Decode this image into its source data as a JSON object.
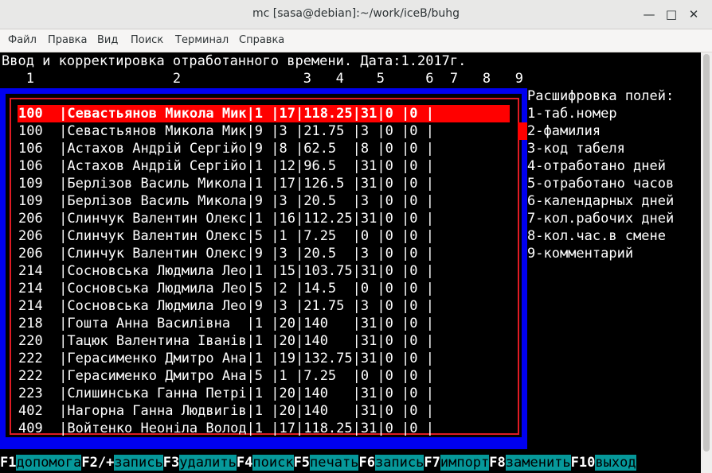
{
  "window": {
    "title": "mc [sasa@debian]:~/work/iceB/buhg"
  },
  "menu": [
    "Файл",
    "Правка",
    "Вид",
    "Поиск",
    "Терминал",
    "Справка"
  ],
  "header": {
    "line": "Ввод и корректировка отработанного времени. Дата:1.2017г.",
    "columns": "   1                 2               3   4    5     6  7   8   9"
  },
  "rows": [
    "100  |Севастьянов Микола Мик|1 |17|118.25|31|0 |0 |",
    "100  |Севастьянов Микола Мик|9 |3 |21.75 |3 |0 |0 |",
    "106  |Астахов Андрій Сергійо|9 |8 |62.5  |8 |0 |0 |",
    "106  |Астахов Андрій Сергійо|1 |12|96.5  |31|0 |0 |",
    "109  |Берлізов Василь Микола|1 |17|126.5 |31|0 |0 |",
    "109  |Берлізов Василь Микола|9 |3 |20.5  |3 |0 |0 |",
    "206  |Слинчук Валентин Олекс|1 |16|112.25|31|0 |0 |",
    "206  |Слинчук Валентин Олекс|5 |1 |7.25  |0 |0 |0 |",
    "206  |Слинчук Валентин Олекс|9 |3 |20.5  |3 |0 |0 |",
    "214  |Сосновська Людмила Лео|1 |15|103.75|31|0 |0 |",
    "214  |Сосновська Людмила Лео|5 |2 |14.5  |0 |0 |0 |",
    "214  |Сосновська Людмила Лео|9 |3 |21.75 |3 |0 |0 |",
    "218  |Гошта Анна Василівна  |1 |20|140   |31|0 |0 |",
    "220  |Тацюк Валентина Іванів|1 |20|140   |31|0 |0 |",
    "222  |Герасименко Дмитро Ана|1 |19|132.75|31|0 |0 |",
    "222  |Герасименко Дмитро Ана|5 |1 |7.25  |0 |0 |0 |",
    "223  |Слишинська Ганна Петрі|1 |20|140   |31|0 |0 |",
    "402  |Нагорна Ганна Людвигів|1 |20|140   |31|0 |0 |",
    "409  |Войтенко Неоніла Волод|1 |17|118.25|31|0 |0 |"
  ],
  "legend": [
    "Расшифровка полей:",
    "1-таб.номер",
    "2-фамилия",
    "3-код табеля",
    "4-отработано дней",
    "5-отработано часов",
    "6-календарных дней",
    "7-кол.рабочих дней",
    "8-кол.час.в смене",
    "9-комментарий"
  ],
  "fkeys": [
    {
      "key": "F1",
      "label": "допомога"
    },
    {
      "key": "F2/+",
      "label": "запись"
    },
    {
      "key": "F3",
      "label": "удалить"
    },
    {
      "key": "F4",
      "label": "поиск"
    },
    {
      "key": "F5",
      "label": "печать"
    },
    {
      "key": "F6",
      "label": "запись"
    },
    {
      "key": "F7",
      "label": "импорт"
    },
    {
      "key": "F8",
      "label": "заменить"
    },
    {
      "key": "F10",
      "label": "выход"
    }
  ]
}
